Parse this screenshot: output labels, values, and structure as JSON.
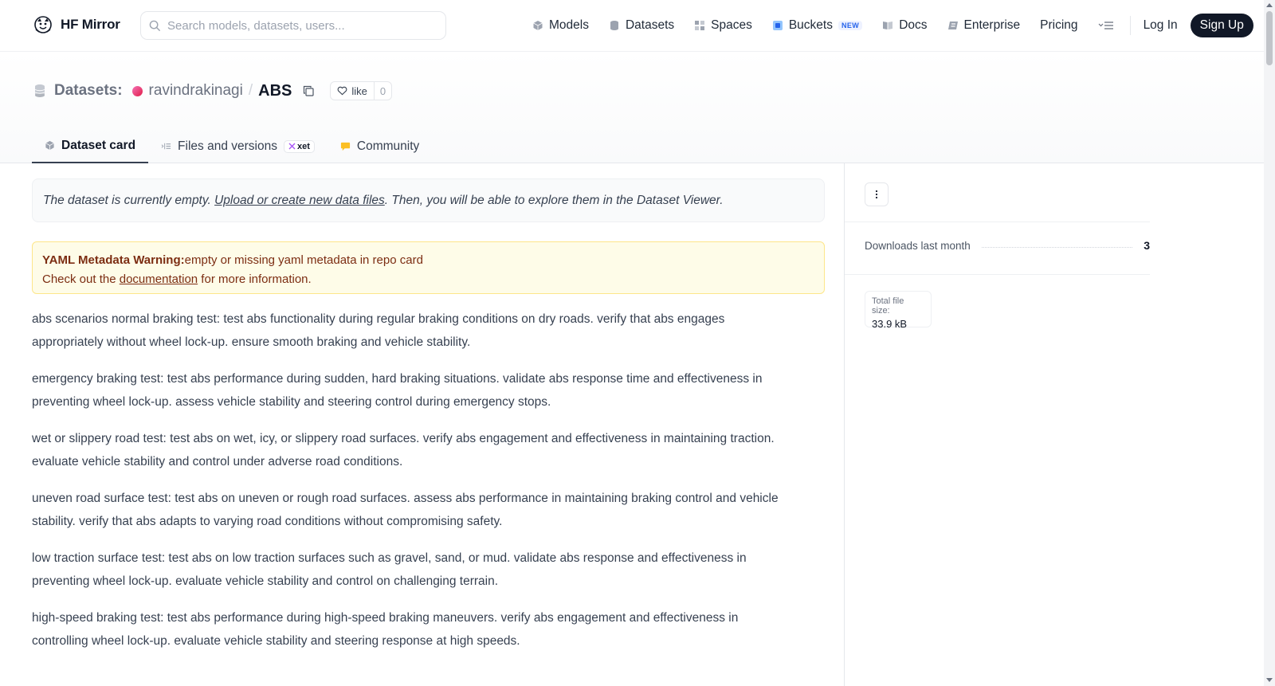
{
  "header": {
    "logo_text": "HF Mirror",
    "search_placeholder": "Search models, datasets, users...",
    "nav": [
      {
        "label": "Models"
      },
      {
        "label": "Datasets"
      },
      {
        "label": "Spaces"
      },
      {
        "label": "Buckets",
        "badge": "NEW"
      },
      {
        "label": "Docs"
      },
      {
        "label": "Enterprise"
      },
      {
        "label": "Pricing"
      }
    ],
    "login_label": "Log In",
    "signup_label": "Sign Up"
  },
  "repo": {
    "section_label": "Datasets:",
    "owner": "ravindrakinagi",
    "separator": "/",
    "name": "ABS",
    "like_label": "like",
    "like_count": "0"
  },
  "tabs": [
    {
      "label": "Dataset card",
      "active": true
    },
    {
      "label": "Files and versions",
      "badge": "xet"
    },
    {
      "label": "Community"
    }
  ],
  "main": {
    "empty_note": {
      "prefix": "The dataset is currently empty. ",
      "link": "Upload or create new data files",
      "suffix": ". Then, you will be able to explore them in the Dataset Viewer."
    },
    "warning": {
      "title": "YAML Metadata Warning:",
      "message": "empty or missing yaml metadata in repo card",
      "line2_prefix": "Check out the ",
      "line2_link": "documentation",
      "line2_suffix": " for more information."
    },
    "paragraphs": [
      "abs scenarios normal braking test: test abs functionality during regular braking conditions on dry roads. verify that abs engages appropriately without wheel lock-up. ensure smooth braking and vehicle stability.",
      "emergency braking test: test abs performance during sudden, hard braking situations. validate abs response time and effectiveness in preventing wheel lock-up. assess vehicle stability and steering control during emergency stops.",
      "wet or slippery road test: test abs on wet, icy, or slippery road surfaces. verify abs engagement and effectiveness in maintaining traction. evaluate vehicle stability and control under adverse road conditions.",
      "uneven road surface test: test abs on uneven or rough road surfaces. assess abs performance in maintaining braking control and vehicle stability. verify that abs adapts to varying road conditions without compromising safety.",
      "low traction surface test: test abs on low traction surfaces such as gravel, sand, or mud. validate abs response and effectiveness in preventing wheel lock-up. evaluate vehicle stability and control on challenging terrain.",
      "high-speed braking test: test abs performance during high-speed braking maneuvers. verify abs engagement and effectiveness in controlling wheel lock-up. evaluate vehicle stability and steering response at high speeds."
    ]
  },
  "sidebar": {
    "downloads_label": "Downloads last month",
    "downloads_value": "3",
    "filesize_label": "Total file size:",
    "filesize_value": "33.9 kB"
  },
  "icons": {
    "logo": "hf-logo-icon",
    "search": "search-icon",
    "models": "cube-icon",
    "datasets": "database-icon",
    "spaces": "grid-icon",
    "buckets": "bucket-icon",
    "docs": "book-icon",
    "enterprise": "enterprise-icon",
    "more": "menu-icon",
    "copy": "copy-icon",
    "like": "heart-icon",
    "files": "files-icon",
    "community": "chat-icon",
    "kebab": "kebab-icon"
  },
  "colors": {
    "accent": "#111827",
    "warning_bg": "#fefce8",
    "warning_text": "#7c2d12",
    "owner_avatar": "#e11d48",
    "buckets_icon": "#2563eb"
  }
}
